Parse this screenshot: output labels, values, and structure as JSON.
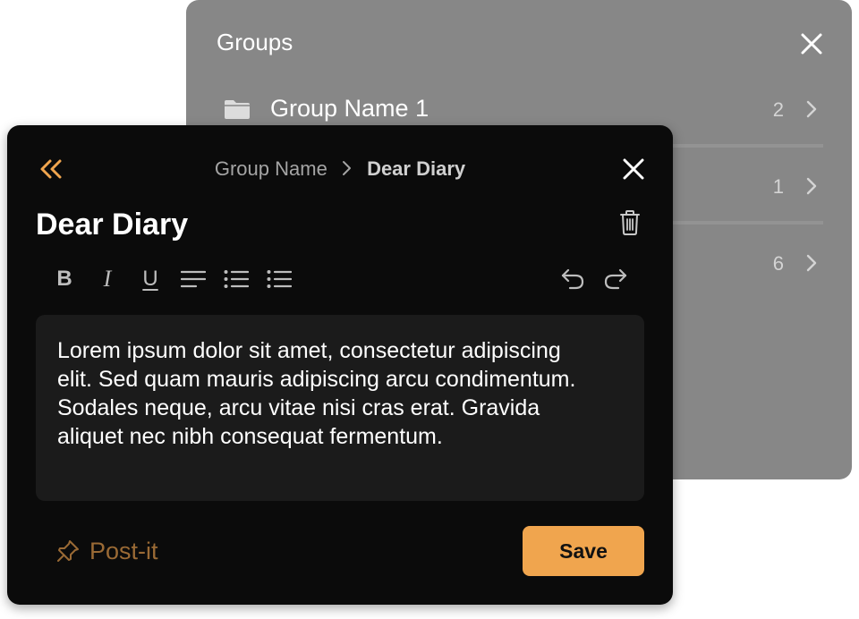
{
  "colors": {
    "accent": "#f0a54e",
    "postit": "#9a6a35",
    "card_bg": "#0b0b0b",
    "editor_bg": "#1b1b1b",
    "groups_bg": "#878787"
  },
  "groups_panel": {
    "title": "Groups",
    "close_icon": "close-icon",
    "items": [
      {
        "name": "Group Name 1",
        "count": "2",
        "icon": "folder-icon"
      },
      {
        "name": "",
        "count": "1"
      },
      {
        "name": "",
        "count": "6"
      }
    ]
  },
  "note": {
    "breadcrumb": {
      "parent": "Group Name",
      "current": "Dear Diary"
    },
    "title": "Dear Diary",
    "toolbar": {
      "bold": "B",
      "italic": "I",
      "underline": "U",
      "align_icon": "align-left-icon",
      "bullets_icon": "bullet-list-icon",
      "numbered_icon": "list-icon",
      "undo_icon": "undo-icon",
      "redo_icon": "redo-icon"
    },
    "body": "Lorem ipsum dolor sit amet, consectetur adipiscing elit. Sed quam mauris adipiscing arcu condimentum. Sodales neque, arcu vitae nisi cras erat. Gravida aliquet nec nibh consequat fermentum.",
    "postit_label": "Post-it",
    "save_label": "Save"
  }
}
